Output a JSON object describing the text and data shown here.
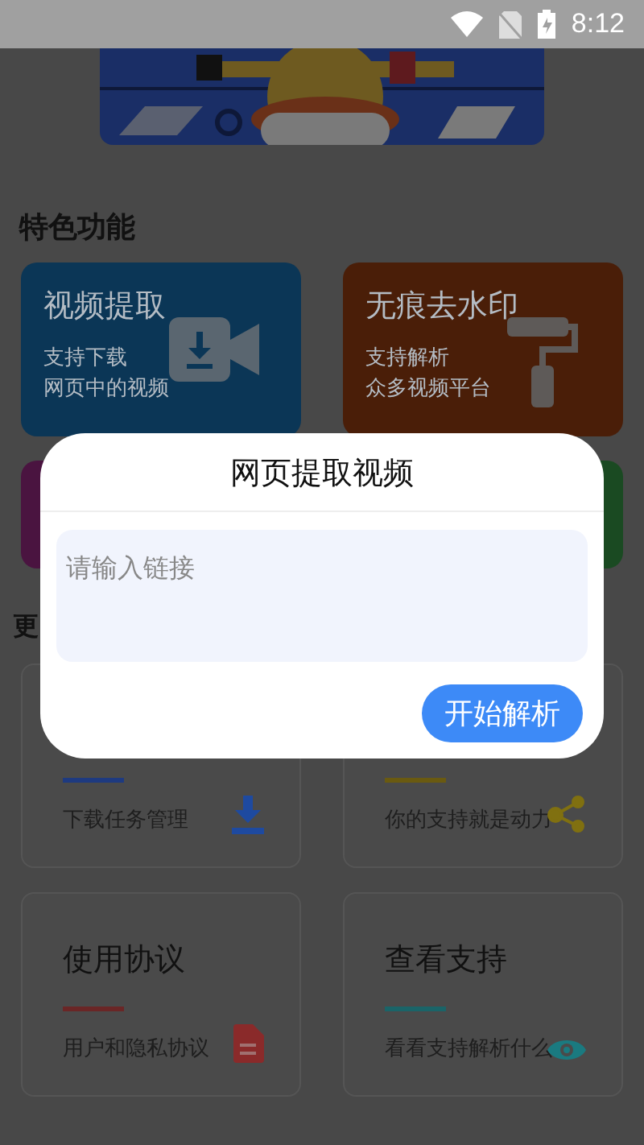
{
  "status_bar": {
    "time": "8:12"
  },
  "features": {
    "title": "特色功能",
    "cards": [
      {
        "title": "视频提取",
        "lines": [
          "支持下载",
          "网页中的视频"
        ],
        "color": "#0b3656"
      },
      {
        "title": "无痕去水印",
        "lines": [
          "支持解析",
          "众多视频平台"
        ],
        "color": "#4a1e08"
      },
      {
        "color": "#4a1440"
      },
      {
        "color": "#1a4a22"
      }
    ]
  },
  "more": {
    "title": "更",
    "tools": [
      {
        "subtitle": "下载任务管理",
        "color": "#1e3a80"
      },
      {
        "subtitle": "你的支持就是动力",
        "color": "#6a5a10"
      },
      {
        "title": "使用协议",
        "subtitle": "用户和隐私协议",
        "color": "#6a2626"
      },
      {
        "title": "查看支持",
        "subtitle": "看看支持解析什么",
        "color": "#1a6468"
      }
    ]
  },
  "dialog": {
    "title": "网页提取视频",
    "input": {
      "placeholder": "请输入链接"
    },
    "button": "开始解析"
  }
}
